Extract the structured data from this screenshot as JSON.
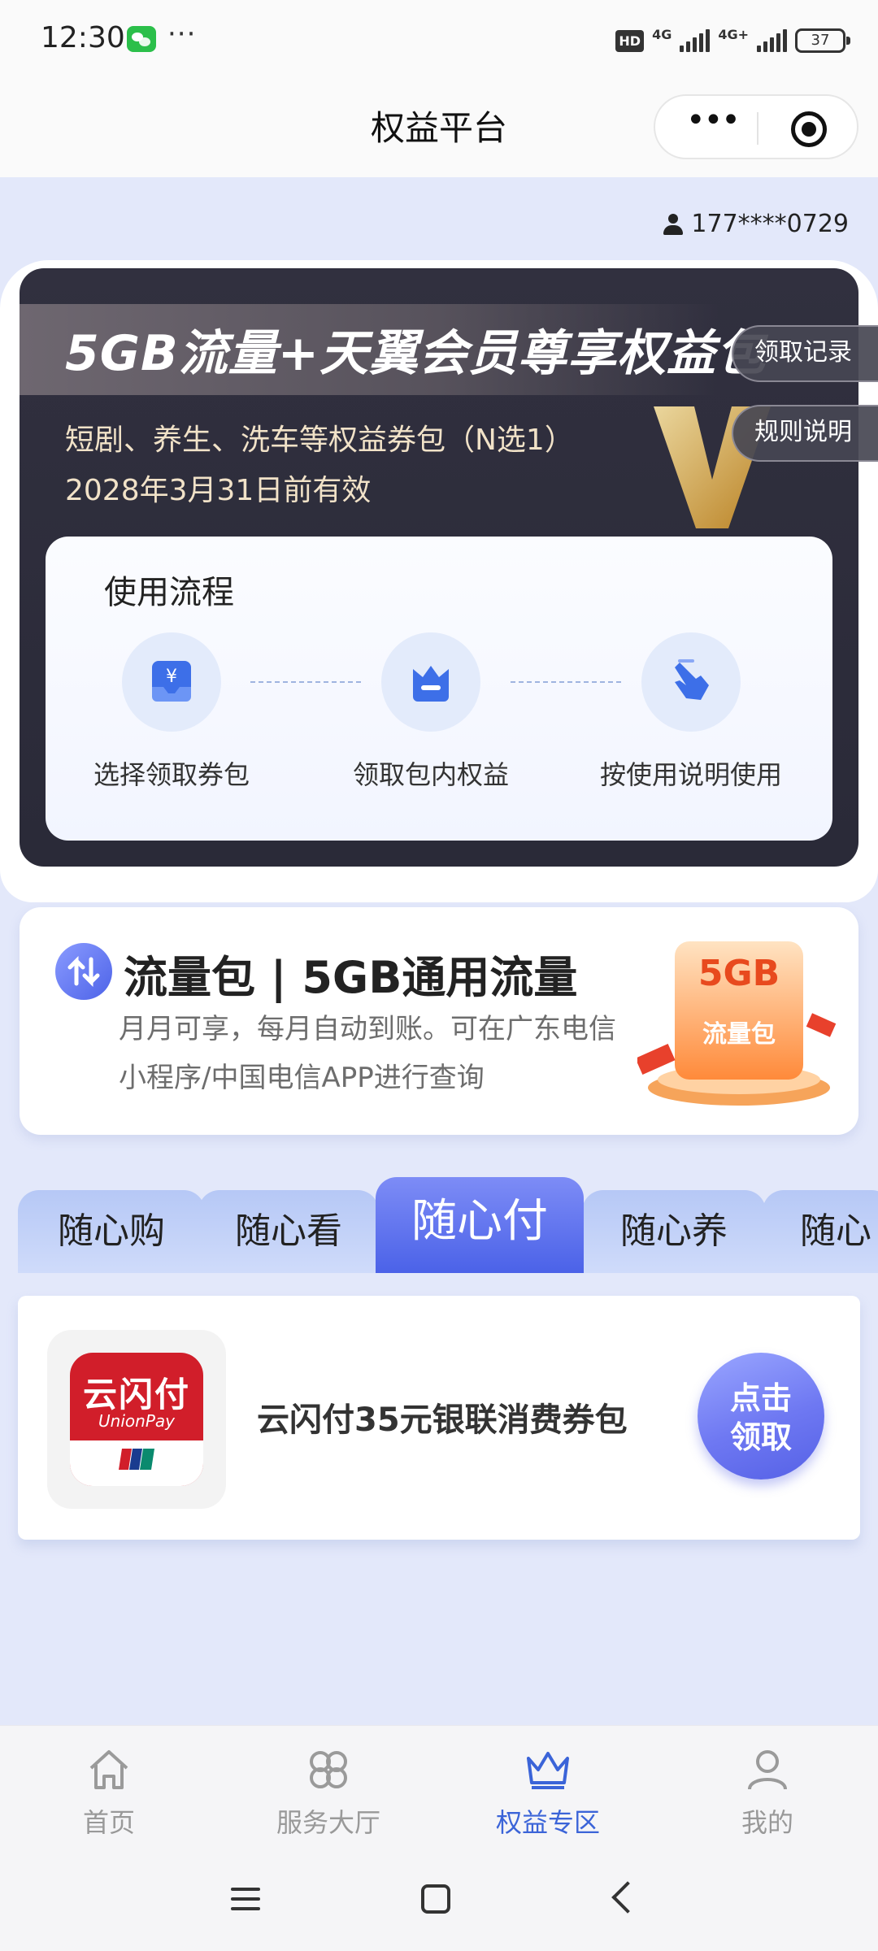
{
  "status_bar": {
    "time": "12:30",
    "dots": "···",
    "hd": "HD",
    "net1": "4G",
    "net2": "4G+",
    "battery": "37",
    "wechat_icon": "wechat-icon"
  },
  "title_bar": {
    "title": "权益平台",
    "more_icon": "more-dots-icon",
    "close_icon": "miniprogram-target-icon"
  },
  "user": {
    "phone": "177****0729",
    "icon": "user-icon"
  },
  "hero": {
    "title": "5GB流量+天翼会员尊享权益包",
    "subtitle": "短剧、养生、洗车等权益券包（N选1）",
    "validity": "2028年3月31日前有效",
    "records_button": "领取记录",
    "rules_button": "规则说明",
    "flow": {
      "title": "使用流程",
      "steps": [
        {
          "label": "选择领取券包",
          "icon": "wallet-yen-icon"
        },
        {
          "label": "领取包内权益",
          "icon": "crown-box-icon"
        },
        {
          "label": "按使用说明使用",
          "icon": "hand-tap-icon"
        }
      ]
    }
  },
  "data_pack": {
    "title": "流量包 | 5GB通用流量",
    "description": "月月可享，每月自动到账。可在广东电信小程序/中国电信APP进行查询",
    "badge_size": "5GB",
    "badge_label": "流量包",
    "icon": "data-arrows-icon"
  },
  "tabs": [
    {
      "label": "随心购",
      "active": false
    },
    {
      "label": "随心看",
      "active": false
    },
    {
      "label": "随心付",
      "active": true
    },
    {
      "label": "随心养",
      "active": false
    },
    {
      "label": "随心",
      "active": false
    }
  ],
  "coupon": {
    "logo_text": "云闪付",
    "logo_sub": "UnionPay",
    "name": "云闪付35元银联消费券包",
    "claim_line1": "点击",
    "claim_line2": "领取"
  },
  "bottom_nav": [
    {
      "label": "首页",
      "icon": "home-icon",
      "active": false
    },
    {
      "label": "服务大厅",
      "icon": "grid-flower-icon",
      "active": false
    },
    {
      "label": "权益专区",
      "icon": "crown-icon",
      "active": true
    },
    {
      "label": "我的",
      "icon": "person-icon",
      "active": false
    }
  ],
  "colors": {
    "accent": "#3b64d8",
    "hero_bg": "#2d2c3a",
    "page_bg": "#e3e8fa",
    "coupon_red": "#d11e2a"
  }
}
